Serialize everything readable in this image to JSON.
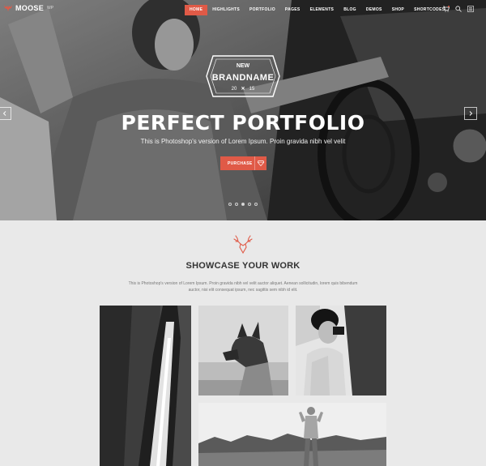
{
  "brand": {
    "name": "MOOSE",
    "tm": "WP",
    "accent": "#e05a47"
  },
  "nav": {
    "items": [
      {
        "label": "HOME",
        "active": true
      },
      {
        "label": "HIGHLIGHTS"
      },
      {
        "label": "PORTFOLIO"
      },
      {
        "label": "PAGES"
      },
      {
        "label": "ELEMENTS"
      },
      {
        "label": "BLOG"
      },
      {
        "label": "DEMOS"
      },
      {
        "label": "SHOP"
      },
      {
        "label": "SHORTCODES"
      }
    ],
    "icons": [
      "cart-icon",
      "search-icon",
      "menu-icon"
    ]
  },
  "hero": {
    "badge_top": "NEW",
    "badge_main": "BRANDNAME",
    "badge_year_left": "20",
    "badge_year_right": "15",
    "title": "PERFECT PORTFOLIO",
    "subtitle": "This is Photoshop's version of Lorem Ipsum. Proin gravida nibh vel velit",
    "button_label": "PURCHASE",
    "slides": 5,
    "active_slide": 3
  },
  "showcase": {
    "title": "SHOWCASE YOUR WORK",
    "text_line1": "This is Photoshop's version of Lorem Ipsum. Proin gravida nibh vel velit auctor aliquet. Aenean sollicitudin, lorem quis bibendum",
    "text_line2": "auctor, nisi elit consequat ipsum, nec sagittis sem nibh id elit."
  },
  "gallery": [
    {
      "name": "waterfall-photo"
    },
    {
      "name": "dog-photo"
    },
    {
      "name": "woman-camera-photo"
    },
    {
      "name": "person-field-photo"
    }
  ]
}
